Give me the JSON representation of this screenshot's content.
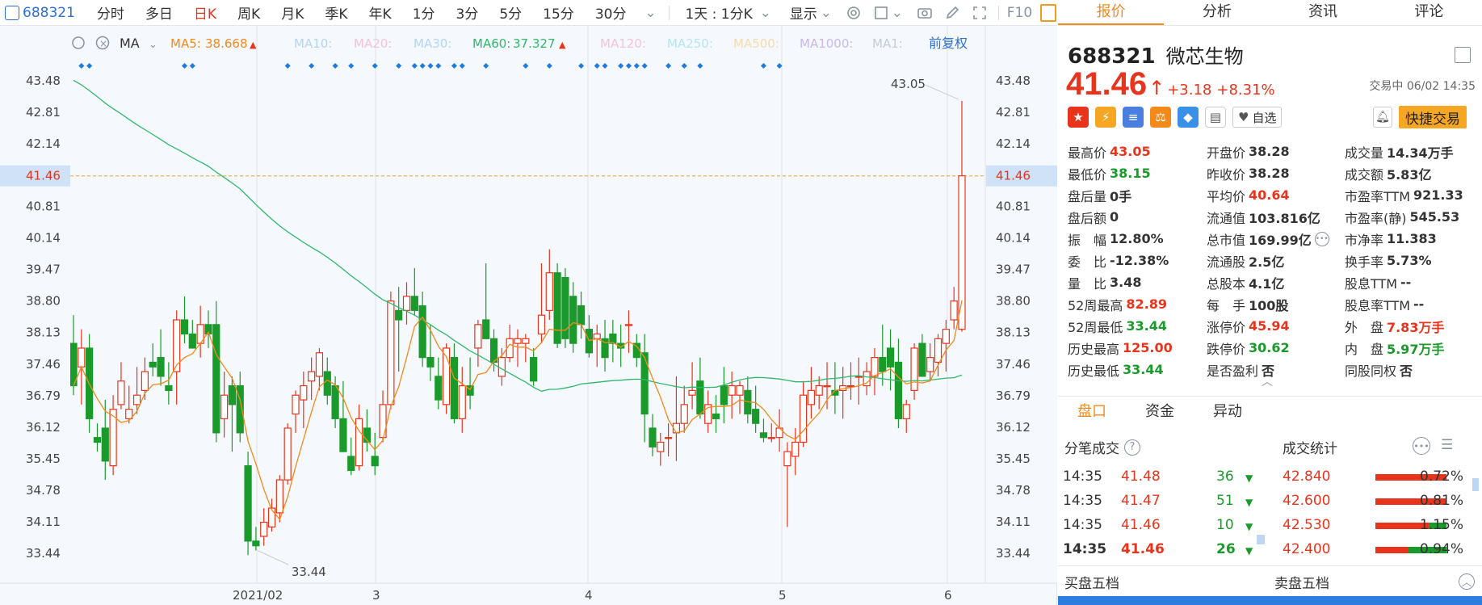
{
  "toolbar": {
    "code": "688321",
    "tabs": [
      "分时",
      "多日",
      "日K",
      "周K",
      "月K",
      "季K",
      "年K",
      "1分",
      "3分",
      "5分",
      "15分",
      "30分"
    ],
    "active_tab": "日K",
    "range_select": "1天 : 1分K",
    "display_select": "显示",
    "fq_label": "F10",
    "icons": [
      "settings-icon",
      "square-icon",
      "camera-icon",
      "pen-icon",
      "expand-icon"
    ]
  },
  "indicator": {
    "name": "MA",
    "ma5_label": "MA5:",
    "ma5_value": "38.668",
    "ma10_label": "MA10:",
    "ma20_label": "MA20:",
    "ma30_label": "MA30:",
    "ma60_label": "MA60:",
    "ma60_value": "37.327",
    "ma120_label": "MA120:",
    "ma250_label": "MA250:",
    "ma500_label": "MA500:",
    "ma1000_label": "MA1000:",
    "ma1_label": "MA1:",
    "fq_mode": "前复权"
  },
  "chart_data": {
    "type": "candlestick",
    "y_ticks": [
      "43.48",
      "42.81",
      "42.14",
      "41.46",
      "40.81",
      "40.14",
      "39.47",
      "38.80",
      "38.13",
      "37.46",
      "36.79",
      "36.12",
      "35.45",
      "34.78",
      "34.11",
      "33.44"
    ],
    "x_labels": [
      "2021/02",
      "3",
      "4",
      "5",
      "6"
    ],
    "current_price_line": "41.46",
    "high_annotation": "43.05",
    "low_annotation": "33.44",
    "ma5_color": "#f28a1a",
    "ma60_color": "#2fb86a",
    "up_color": "#e8341c",
    "down_color": "#1a9a2a",
    "ylim": [
      33.1,
      43.8
    ],
    "candles": [
      [
        37.9,
        38.5,
        36.8,
        37.0
      ],
      [
        37.4,
        38.2,
        36.6,
        37.8
      ],
      [
        37.8,
        38.1,
        36.0,
        36.3
      ],
      [
        35.9,
        36.2,
        35.6,
        35.8
      ],
      [
        36.1,
        36.7,
        35.0,
        35.4
      ],
      [
        35.3,
        36.8,
        35.1,
        36.5
      ],
      [
        36.6,
        37.5,
        36.5,
        37.1
      ],
      [
        36.3,
        37.0,
        36.2,
        36.5
      ],
      [
        36.6,
        37.4,
        36.4,
        36.8
      ],
      [
        36.9,
        37.6,
        36.7,
        37.3
      ],
      [
        37.5,
        37.9,
        37.2,
        37.4
      ],
      [
        37.6,
        38.2,
        37.0,
        37.2
      ],
      [
        37.0,
        37.5,
        36.6,
        36.9
      ],
      [
        37.3,
        38.6,
        36.6,
        38.4
      ],
      [
        38.4,
        38.9,
        37.9,
        38.1
      ],
      [
        38.1,
        38.4,
        37.8,
        37.8
      ],
      [
        37.9,
        38.7,
        37.6,
        38.3
      ],
      [
        38.3,
        38.6,
        37.8,
        38.1
      ],
      [
        38.3,
        38.8,
        35.8,
        36.0
      ],
      [
        36.3,
        37.3,
        35.9,
        36.8
      ],
      [
        37.0,
        37.2,
        35.6,
        36.6
      ],
      [
        37.0,
        37.3,
        35.8,
        36.0
      ],
      [
        35.3,
        35.6,
        33.4,
        33.7
      ],
      [
        33.7,
        34.0,
        33.5,
        33.6
      ],
      [
        33.8,
        34.4,
        33.6,
        34.1
      ],
      [
        34.0,
        34.6,
        33.9,
        34.4
      ],
      [
        34.3,
        35.1,
        34.1,
        35.0
      ],
      [
        35.0,
        36.2,
        34.9,
        36.1
      ],
      [
        36.4,
        36.9,
        36.0,
        36.8
      ],
      [
        36.7,
        37.3,
        36.1,
        37.0
      ],
      [
        37.1,
        37.6,
        36.7,
        37.3
      ],
      [
        37.2,
        37.8,
        36.9,
        37.7
      ],
      [
        37.3,
        37.6,
        36.6,
        36.8
      ],
      [
        37.0,
        37.2,
        36.1,
        36.3
      ],
      [
        36.3,
        37.1,
        35.6,
        35.6
      ],
      [
        35.5,
        35.9,
        35.1,
        35.2
      ],
      [
        35.3,
        36.6,
        35.2,
        36.3
      ],
      [
        36.1,
        36.5,
        35.6,
        35.8
      ],
      [
        35.5,
        36.0,
        35.1,
        35.3
      ],
      [
        35.9,
        36.9,
        35.8,
        36.6
      ],
      [
        36.6,
        39.0,
        36.5,
        38.8
      ],
      [
        38.6,
        39.1,
        37.3,
        38.4
      ],
      [
        38.6,
        39.2,
        38.3,
        38.9
      ],
      [
        38.9,
        39.5,
        38.5,
        38.6
      ],
      [
        38.7,
        39.0,
        37.4,
        37.6
      ],
      [
        37.6,
        38.3,
        37.1,
        37.4
      ],
      [
        37.2,
        37.6,
        36.5,
        36.7
      ],
      [
        36.6,
        37.9,
        36.4,
        37.8
      ],
      [
        37.6,
        37.9,
        36.2,
        36.3
      ],
      [
        36.3,
        37.4,
        36.0,
        37.0
      ],
      [
        37.0,
        37.6,
        36.5,
        36.8
      ],
      [
        37.8,
        38.4,
        37.4,
        38.3
      ],
      [
        38.4,
        39.6,
        38.2,
        38.0
      ],
      [
        38.0,
        38.2,
        37.3,
        37.5
      ],
      [
        37.2,
        37.8,
        37.0,
        37.6
      ],
      [
        37.6,
        38.3,
        37.5,
        38.0
      ],
      [
        37.9,
        38.2,
        37.4,
        38.0
      ],
      [
        37.9,
        38.1,
        37.5,
        38.0
      ],
      [
        37.6,
        37.8,
        37.0,
        37.1
      ],
      [
        38.1,
        39.6,
        37.9,
        38.5
      ],
      [
        38.6,
        39.9,
        38.4,
        39.4
      ],
      [
        39.4,
        39.6,
        37.8,
        37.9
      ],
      [
        39.3,
        39.5,
        37.8,
        38.0
      ],
      [
        38.9,
        39.2,
        37.7,
        37.9
      ],
      [
        38.7,
        39.0,
        38.0,
        38.3
      ],
      [
        38.2,
        38.5,
        37.6,
        37.7
      ],
      [
        38.0,
        38.3,
        37.4,
        38.1
      ],
      [
        38.0,
        38.4,
        37.3,
        37.6
      ],
      [
        38.1,
        38.4,
        37.5,
        37.9
      ],
      [
        37.9,
        38.3,
        37.4,
        37.8
      ],
      [
        38.3,
        38.6,
        37.7,
        38.3
      ],
      [
        37.9,
        38.1,
        37.4,
        37.6
      ],
      [
        37.7,
        38.1,
        35.8,
        36.4
      ],
      [
        36.1,
        36.4,
        35.5,
        35.7
      ],
      [
        35.6,
        36.0,
        35.3,
        35.8
      ],
      [
        35.9,
        36.2,
        35.5,
        35.9
      ],
      [
        36.0,
        37.2,
        35.4,
        36.2
      ],
      [
        36.2,
        37.0,
        36.0,
        36.6
      ],
      [
        36.8,
        37.5,
        36.5,
        36.9
      ],
      [
        37.1,
        37.6,
        36.3,
        36.4
      ],
      [
        36.2,
        36.9,
        36.0,
        36.6
      ],
      [
        36.4,
        36.8,
        36.0,
        36.3
      ],
      [
        37.0,
        37.4,
        36.2,
        36.6
      ],
      [
        36.8,
        37.3,
        36.3,
        37.0
      ],
      [
        36.8,
        37.1,
        36.4,
        37.0
      ],
      [
        36.9,
        37.2,
        36.2,
        36.4
      ],
      [
        36.5,
        37.0,
        36.0,
        36.2
      ],
      [
        36.0,
        36.3,
        35.8,
        35.9
      ],
      [
        35.9,
        36.2,
        35.8,
        35.9
      ],
      [
        35.9,
        36.5,
        35.6,
        36.1
      ],
      [
        35.3,
        35.8,
        34.0,
        35.6
      ],
      [
        35.5,
        36.1,
        35.1,
        35.8
      ],
      [
        35.8,
        37.1,
        35.7,
        36.8
      ],
      [
        36.6,
        37.4,
        36.3,
        36.9
      ],
      [
        36.8,
        37.2,
        36.5,
        37.0
      ],
      [
        37.0,
        37.5,
        36.5,
        37.0
      ],
      [
        36.9,
        37.5,
        36.4,
        36.8
      ],
      [
        36.9,
        37.4,
        36.3,
        37.0
      ],
      [
        37.0,
        37.5,
        36.7,
        37.0
      ],
      [
        37.2,
        37.6,
        36.6,
        37.2
      ],
      [
        37.0,
        37.5,
        36.8,
        37.3
      ],
      [
        37.2,
        37.8,
        36.8,
        37.6
      ],
      [
        37.6,
        38.3,
        37.0,
        37.3
      ],
      [
        37.8,
        38.2,
        36.9,
        37.4
      ],
      [
        37.5,
        38.0,
        36.1,
        36.3
      ],
      [
        36.3,
        36.7,
        36.0,
        36.6
      ],
      [
        36.9,
        37.9,
        36.7,
        37.8
      ],
      [
        37.9,
        38.1,
        37.2,
        37.2
      ],
      [
        37.3,
        37.9,
        37.1,
        37.6
      ],
      [
        37.5,
        38.1,
        37.2,
        38.0
      ],
      [
        37.9,
        38.4,
        37.3,
        38.2
      ],
      [
        38.4,
        39.1,
        38.2,
        38.8
      ],
      [
        38.2,
        43.05,
        38.15,
        41.46
      ]
    ]
  },
  "right_tabs": [
    "报价",
    "分析",
    "资讯",
    "评论"
  ],
  "stock": {
    "code": "688321",
    "name": "微芯生物",
    "price": "41.46",
    "change": "+3.18",
    "change_pct": "+8.31%",
    "trade_status": "交易中 06/02 14:35",
    "watch_label": "自选",
    "quick_trade_label": "快捷交易"
  },
  "stats": [
    [
      [
        "最高价",
        "43.05",
        "red"
      ],
      [
        "开盘价",
        "38.28",
        "plain"
      ],
      [
        "成交量",
        "14.34万手",
        "plain"
      ]
    ],
    [
      [
        "最低价",
        "38.15",
        "green"
      ],
      [
        "昨收价",
        "38.28",
        "plain"
      ],
      [
        "成交额",
        "5.83亿",
        "plain"
      ]
    ],
    [
      [
        "盘后量",
        "0手",
        "plain"
      ],
      [
        "平均价",
        "40.64",
        "red"
      ],
      [
        "市盈率TTM",
        "921.33",
        "plain"
      ]
    ],
    [
      [
        "盘后额",
        "0",
        "plain"
      ],
      [
        "流通值",
        "103.816亿",
        "plain"
      ],
      [
        "市盈率(静)",
        "545.53",
        "plain"
      ]
    ],
    [
      [
        "振　幅",
        "12.80%",
        "plain"
      ],
      [
        "总市值",
        "169.99亿",
        "plain"
      ],
      [
        "市净率",
        "11.383",
        "plain"
      ]
    ],
    [
      [
        "委　比",
        "-12.38%",
        "plain"
      ],
      [
        "流通股",
        "2.5亿",
        "plain"
      ],
      [
        "换手率",
        "5.73%",
        "plain"
      ]
    ],
    [
      [
        "量　比",
        "3.48",
        "plain"
      ],
      [
        "总股本",
        "4.1亿",
        "plain"
      ],
      [
        "股息TTM",
        "--",
        "plain"
      ]
    ],
    [
      [
        "52周最高",
        "82.89",
        "red"
      ],
      [
        "每　手",
        "100股",
        "plain"
      ],
      [
        "股息率TTM",
        "--",
        "plain"
      ]
    ],
    [
      [
        "52周最低",
        "33.44",
        "green"
      ],
      [
        "涨停价",
        "45.94",
        "red"
      ],
      [
        "外　盘",
        "7.83万手",
        "red"
      ]
    ],
    [
      [
        "历史最高",
        "125.00",
        "red"
      ],
      [
        "跌停价",
        "30.62",
        "green"
      ],
      [
        "内　盘",
        "5.97万手",
        "green"
      ]
    ],
    [
      [
        "历史最低",
        "33.44",
        "green"
      ],
      [
        "是否盈利",
        "否",
        "plain"
      ],
      [
        "同股同权",
        "否",
        "plain"
      ]
    ]
  ],
  "panel_tabs": [
    "盘口",
    "资金",
    "异动"
  ],
  "ticks_header": {
    "left": "分笔成交",
    "right": "成交统计"
  },
  "trades": [
    {
      "time": "14:35",
      "price": "41.48",
      "vol": "36",
      "stat_price": "42.840",
      "pct": "0.72%",
      "green_frac": 0.0
    },
    {
      "time": "14:35",
      "price": "41.47",
      "vol": "51",
      "stat_price": "42.600",
      "pct": "0.81%",
      "green_frac": 0.0
    },
    {
      "time": "14:35",
      "price": "41.46",
      "vol": "10",
      "stat_price": "42.530",
      "pct": "1.15%",
      "green_frac": 0.25
    },
    {
      "time": "14:35",
      "price": "41.46",
      "vol": "26",
      "stat_price": "42.400",
      "pct": "0.94%",
      "green_frac": 0.55
    }
  ],
  "five_levels": {
    "buy": "买盘五档",
    "sell": "卖盘五档"
  }
}
